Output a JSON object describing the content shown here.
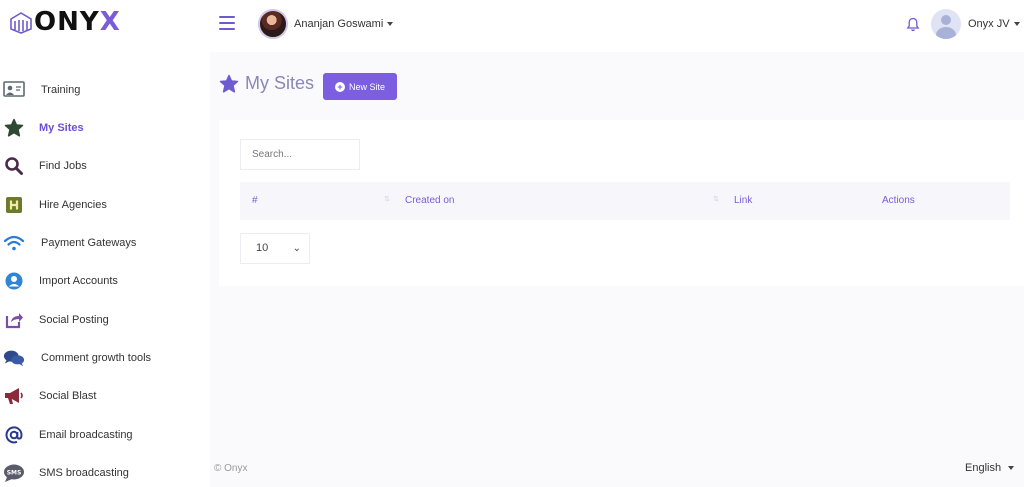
{
  "brand": {
    "name_main": "ONY",
    "name_accent": "X"
  },
  "header": {
    "user_name": "Ananjan Goswami",
    "account_name": "Onyx JV"
  },
  "sidebar": {
    "items": [
      {
        "label": "Training",
        "icon": "training-icon"
      },
      {
        "label": "My Sites",
        "icon": "star-icon",
        "active": true
      },
      {
        "label": "Find Jobs",
        "icon": "search-icon"
      },
      {
        "label": "Hire Agencies",
        "icon": "h-badge-icon"
      },
      {
        "label": "Payment Gateways",
        "icon": "wifi-icon"
      },
      {
        "label": "Import Accounts",
        "icon": "user-circle-icon"
      },
      {
        "label": "Social Posting",
        "icon": "share-icon"
      },
      {
        "label": "Comment growth tools",
        "icon": "comments-icon"
      },
      {
        "label": "Social Blast",
        "icon": "megaphone-icon"
      },
      {
        "label": "Email broadcasting",
        "icon": "at-icon"
      },
      {
        "label": "SMS broadcasting",
        "icon": "sms-icon"
      }
    ]
  },
  "main": {
    "title": "My Sites",
    "new_site_label": "New Site",
    "search_placeholder": "Search...",
    "table": {
      "columns": [
        "#",
        "Created on",
        "Link",
        "Actions"
      ]
    },
    "page_size": "10"
  },
  "footer": {
    "copyright": "© Onyx",
    "language": "English"
  },
  "colors": {
    "accent": "#7b5fe0",
    "title": "#8a86b8"
  }
}
